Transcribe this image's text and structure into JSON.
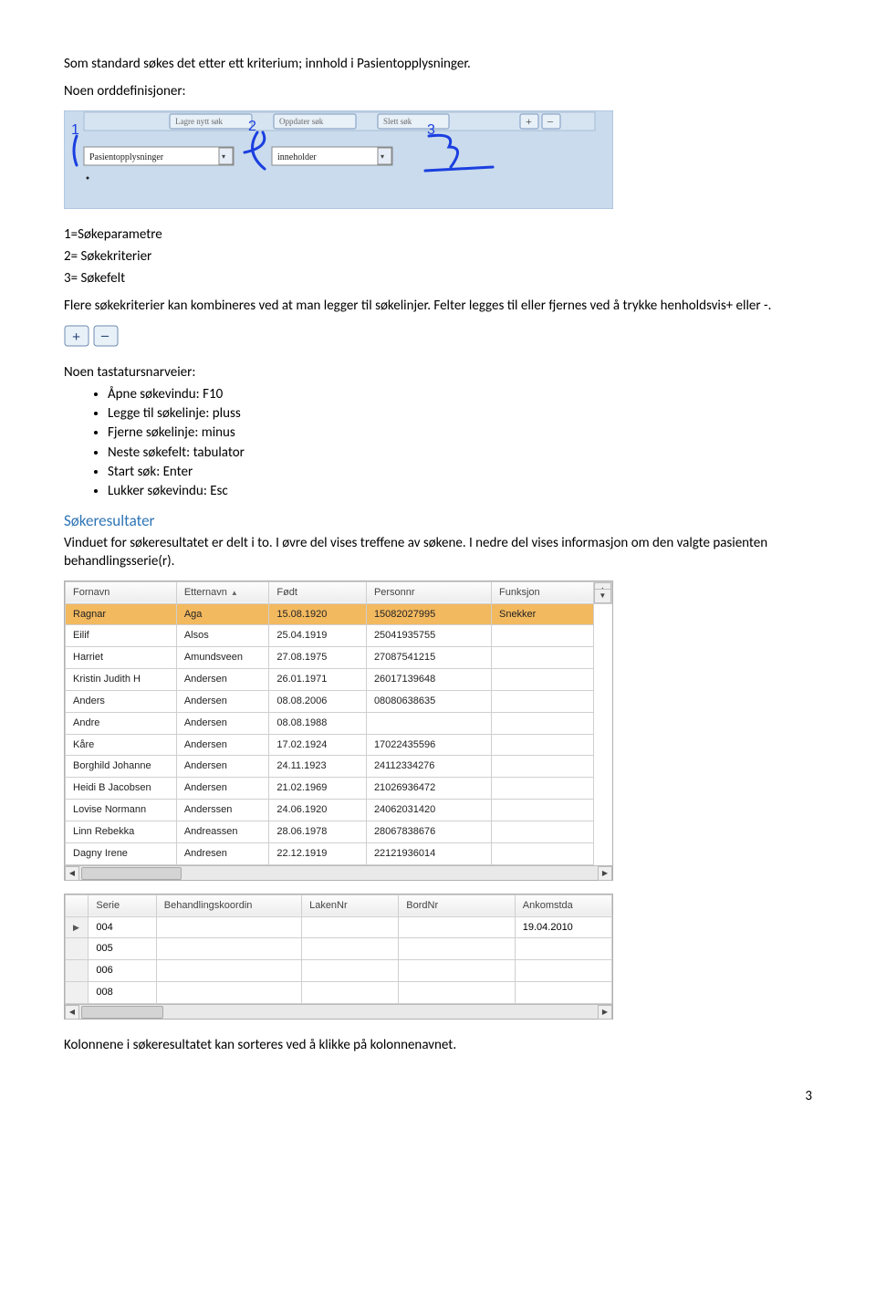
{
  "intro_line": "Som standard søkes det etter ett kriterium; innhold i Pasientopplysninger.",
  "defs_heading": "Noen orddefinisjoner:",
  "toolbar": {
    "buttons": [
      "Lagre nytt søk",
      "Oppdater søk",
      "Slett søk"
    ],
    "field1": "Pasientopplysninger",
    "field2": "inneholder",
    "annotations": [
      "1",
      "2",
      "3"
    ]
  },
  "defs_list": {
    "l1": "1=Søkeparametre",
    "l2": "2= Søkekriterier",
    "l3": "3= Søkefelt"
  },
  "combine_text": "Flere søkekriterier kan kombineres ved at man legger til søkelinjer. Felter legges til eller fjernes ved å trykke henholdsvis+ eller -.",
  "plusminus": {
    "plus": "+",
    "minus": "–"
  },
  "shortcuts_heading": "Noen tastatursnarveier:",
  "shortcuts": [
    "Åpne søkevindu: F10",
    "Legge til søkelinje: pluss",
    "Fjerne søkelinje: minus",
    "Neste søkefelt: tabulator",
    "Start søk: Enter",
    "Lukker søkevindu: Esc"
  ],
  "results_heading": "Søkeresultater",
  "results_text": "Vinduet for søkeresultatet er delt i to. I øvre del vises treffene av søkene. I nedre del vises informasjon om den valgte pasienten behandlingsserie(r).",
  "table": {
    "headers": {
      "fornavn": "Fornavn",
      "etternavn": "Etternavn",
      "fodt": "Født",
      "personnr": "Personnr",
      "funksjon": "Funksjon"
    },
    "rows": [
      {
        "fornavn": "Ragnar",
        "etternavn": "Aga",
        "fodt": "15.08.1920",
        "personnr": "15082027995",
        "funksjon": "Snekker",
        "selected": true
      },
      {
        "fornavn": "Eilif",
        "etternavn": "Alsos",
        "fodt": "25.04.1919",
        "personnr": "25041935755",
        "funksjon": ""
      },
      {
        "fornavn": "Harriet",
        "etternavn": "Amundsveen",
        "fodt": "27.08.1975",
        "personnr": "27087541215",
        "funksjon": ""
      },
      {
        "fornavn": "Kristin Judith H",
        "etternavn": "Andersen",
        "fodt": "26.01.1971",
        "personnr": "26017139648",
        "funksjon": ""
      },
      {
        "fornavn": "Anders",
        "etternavn": "Andersen",
        "fodt": "08.08.2006",
        "personnr": "08080638635",
        "funksjon": ""
      },
      {
        "fornavn": "Andre",
        "etternavn": "Andersen",
        "fodt": "08.08.1988",
        "personnr": "",
        "funksjon": ""
      },
      {
        "fornavn": "Kåre",
        "etternavn": "Andersen",
        "fodt": "17.02.1924",
        "personnr": "17022435596",
        "funksjon": ""
      },
      {
        "fornavn": "Borghild Johanne",
        "etternavn": "Andersen",
        "fodt": "24.11.1923",
        "personnr": "24112334276",
        "funksjon": ""
      },
      {
        "fornavn": "Heidi B Jacobsen",
        "etternavn": "Andersen",
        "fodt": "21.02.1969",
        "personnr": "21026936472",
        "funksjon": ""
      },
      {
        "fornavn": "Lovise Normann",
        "etternavn": "Anderssen",
        "fodt": "24.06.1920",
        "personnr": "24062031420",
        "funksjon": ""
      },
      {
        "fornavn": "Linn Rebekka",
        "etternavn": "Andreassen",
        "fodt": "28.06.1978",
        "personnr": "28067838676",
        "funksjon": ""
      },
      {
        "fornavn": "Dagny Irene",
        "etternavn": "Andresen",
        "fodt": "22.12.1919",
        "personnr": "22121936014",
        "funksjon": ""
      }
    ]
  },
  "series": {
    "headers": {
      "serie": "Serie",
      "koordin": "Behandlingskoordin",
      "laken": "LakenNr",
      "bord": "BordNr",
      "ankomst": "Ankomstda"
    },
    "rows": [
      {
        "serie": "004",
        "koordin": "",
        "laken": "",
        "bord": "",
        "ankomst": "19.04.2010",
        "current": true
      },
      {
        "serie": "005",
        "koordin": "",
        "laken": "",
        "bord": "",
        "ankomst": ""
      },
      {
        "serie": "006",
        "koordin": "",
        "laken": "",
        "bord": "",
        "ankomst": ""
      },
      {
        "serie": "008",
        "koordin": "",
        "laken": "",
        "bord": "",
        "ankomst": ""
      }
    ]
  },
  "footer_text": "Kolonnene i søkeresultatet kan sorteres ved å klikke på kolonnenavnet.",
  "page_number": "3"
}
